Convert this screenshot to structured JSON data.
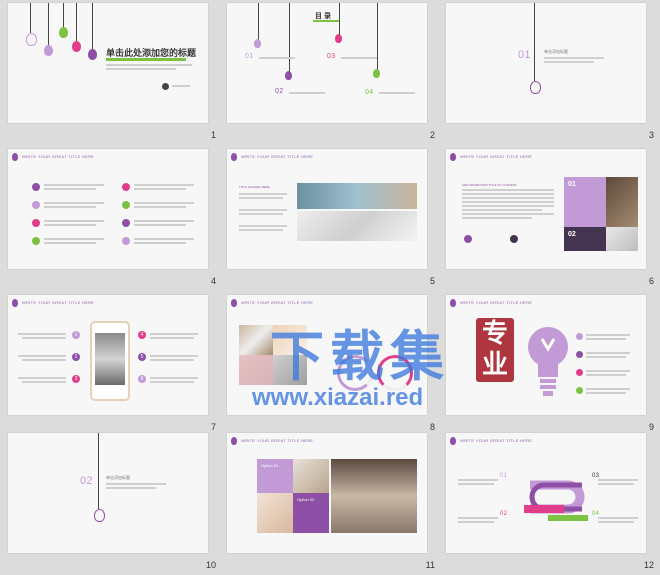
{
  "slides": [
    {
      "number": "1",
      "title": "单击此处添加您的标题"
    },
    {
      "number": "2",
      "title": "目 录",
      "badges": [
        "01",
        "02",
        "03",
        "04"
      ]
    },
    {
      "number": "3",
      "badge": "01",
      "section": "单击添加标题"
    },
    {
      "number": "4",
      "header": "WRITE YOUR GREAT TITLE HERE"
    },
    {
      "number": "5",
      "header": "WRITE YOUR GREAT TITLE HERE",
      "caption": "TITLE HOLDER HERE"
    },
    {
      "number": "6",
      "header": "WRITE YOUR GREAT TITLE HERE",
      "caption": "ADD PROMOTION TITLE TO CONTENT",
      "badges": [
        "01",
        "02"
      ]
    },
    {
      "number": "7",
      "header": "WRITE YOUR GREAT TITLE HERE",
      "steps": [
        "1",
        "2",
        "3",
        "4",
        "5",
        "6"
      ]
    },
    {
      "number": "8",
      "header": "WRITE YOUR GREAT TITLE HERE"
    },
    {
      "number": "9",
      "header": "WRITE YOUR GREAT TITLE HERE"
    },
    {
      "number": "10",
      "badge": "02",
      "section": "单击添加标题"
    },
    {
      "number": "11",
      "header": "WRITE YOUR GREAT TITLE HERE",
      "captions": [
        "Option 01",
        "Option 02"
      ]
    },
    {
      "number": "12",
      "header": "WRITE YOUR GREAT TITLE HERE",
      "badges": [
        "01",
        "02",
        "03",
        "04"
      ]
    }
  ],
  "watermark": {
    "main": "下载集",
    "seal_line1": "专",
    "seal_line2": "业",
    "url": "www.xiazai.red"
  },
  "colors": {
    "purple": "#8e4fa6",
    "pink": "#e03e8a",
    "green": "#7cc242",
    "lavender": "#c19ad6",
    "dark": "#44344f"
  }
}
